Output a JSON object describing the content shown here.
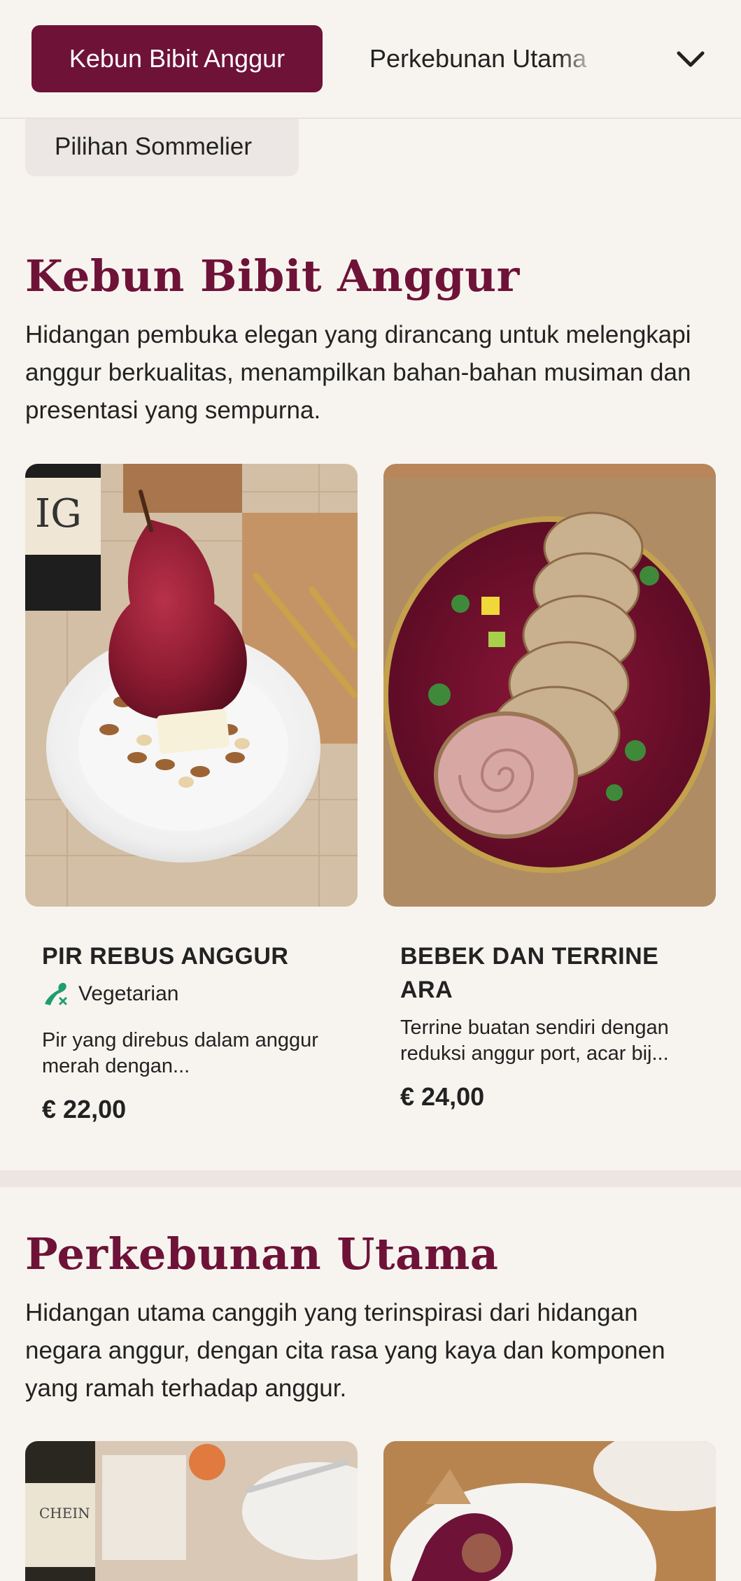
{
  "nav": {
    "active_tab": "Kebun Bibit Anggur",
    "next_tab": "Perkebunan Utama",
    "sub_tab": "Pilihan Sommelier"
  },
  "sections": [
    {
      "title": "Kebun Bibit Anggur",
      "description": "Hidangan pembuka elegan yang dirancang untuk melengkapi anggur berkualitas, menampilkan bahan-bahan musiman dan presentasi yang sempurna.",
      "items": [
        {
          "name": "PIR REBUS ANGGUR",
          "tag": "Vegetarian",
          "description": "Pir yang direbus dalam anggur merah dengan...",
          "price": "€ 22,00"
        },
        {
          "name": "BEBEK DAN TERRINE ARA",
          "description": "Terrine buatan sendiri dengan reduksi anggur port, acar bij...",
          "price": "€ 24,00"
        }
      ]
    },
    {
      "title": "Perkebunan Utama",
      "description": "Hidangan utama canggih yang terinspirasi dari hidangan negara anggur, dengan cita rasa yang kaya dan komponen yang ramah terhadap anggur."
    }
  ],
  "colors": {
    "brand": "#6e1238",
    "background": "#f7f4ef",
    "veg_icon": "#1f9d6b"
  }
}
